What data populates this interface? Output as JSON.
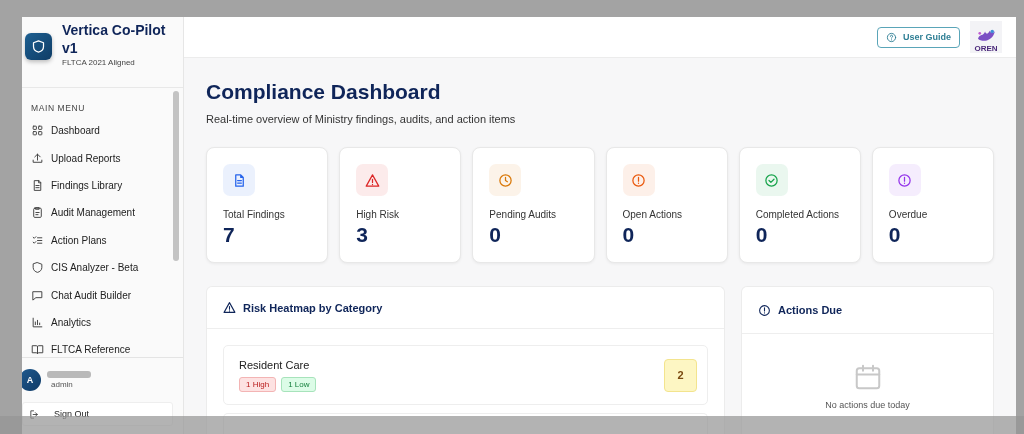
{
  "app": {
    "name": "Vertica Co-Pilot v1",
    "tagline": "FLTCA 2021 Aligned"
  },
  "sidebar": {
    "section": "MAIN MENU",
    "items": [
      {
        "label": "Dashboard",
        "selected": false
      },
      {
        "label": "Upload Reports",
        "selected": false
      },
      {
        "label": "Findings Library",
        "selected": false
      },
      {
        "label": "Audit Management",
        "selected": false
      },
      {
        "label": "Action Plans",
        "selected": false
      },
      {
        "label": "CIS Analyzer - Beta",
        "selected": false
      },
      {
        "label": "Chat Audit Builder",
        "selected": false
      },
      {
        "label": "Analytics",
        "selected": false
      },
      {
        "label": "FLTCA Reference",
        "selected": false
      }
    ],
    "user": {
      "initial": "A",
      "role": "admin"
    },
    "sign_out": "Sign Out"
  },
  "header": {
    "user_guide": "User Guide",
    "logo_text": "OREN"
  },
  "page": {
    "title": "Compliance Dashboard",
    "subtitle": "Real-time overview of Ministry findings, audits, and action items"
  },
  "stats": [
    {
      "label": "Total Findings",
      "value": "7",
      "color": "#2563eb"
    },
    {
      "label": "High Risk",
      "value": "3",
      "color": "#dc2626"
    },
    {
      "label": "Pending Audits",
      "value": "0",
      "color": "#d97706"
    },
    {
      "label": "Open Actions",
      "value": "0",
      "color": "#ea580c"
    },
    {
      "label": "Completed Actions",
      "value": "0",
      "color": "#16a34a"
    },
    {
      "label": "Overdue",
      "value": "0",
      "color": "#9333ea"
    }
  ],
  "heatmap": {
    "title": "Risk Heatmap by Category",
    "categories": [
      {
        "name": "Resident Care",
        "count": "2",
        "tags": [
          {
            "label": "1 High",
            "kind": "high"
          },
          {
            "label": "1 Low",
            "kind": "low"
          }
        ]
      }
    ]
  },
  "actions_due": {
    "title": "Actions Due",
    "empty": "No actions due today"
  }
}
